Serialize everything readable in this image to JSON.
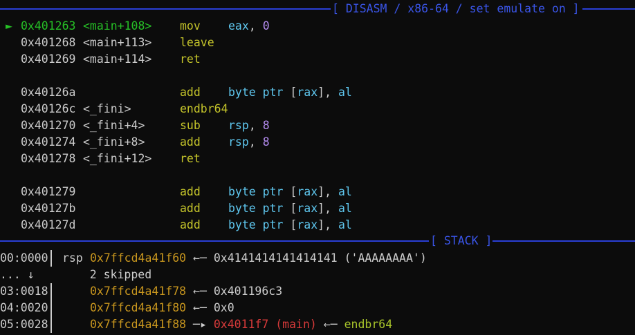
{
  "disasm": {
    "header": "[ DISASM / x86-64 / set emulate on ]",
    "current_marker": "►",
    "rows": [
      {
        "addr": "0x401263",
        "sym": "<main+108>",
        "mnem": "mov",
        "ops": [
          {
            "t": "eax",
            "c": "reg"
          },
          {
            "t": ", ",
            "c": "plain"
          },
          {
            "t": "0",
            "c": "num"
          }
        ],
        "current": true
      },
      {
        "addr": "0x401268",
        "sym": "<main+113>",
        "mnem": "leave",
        "ops": []
      },
      {
        "addr": "0x401269",
        "sym": "<main+114>",
        "mnem": "ret",
        "ops": []
      },
      {
        "blank": true
      },
      {
        "addr": "0x40126a",
        "sym": "",
        "mnem": "add",
        "ops": [
          {
            "t": "byte ptr ",
            "c": "reg"
          },
          {
            "t": "[",
            "c": "plain"
          },
          {
            "t": "rax",
            "c": "reg"
          },
          {
            "t": "], ",
            "c": "plain"
          },
          {
            "t": "al",
            "c": "reg"
          }
        ]
      },
      {
        "addr": "0x40126c",
        "sym": "<_fini>",
        "mnem": "endbr64",
        "ops": []
      },
      {
        "addr": "0x401270",
        "sym": "<_fini+4>",
        "mnem": "sub",
        "ops": [
          {
            "t": "rsp",
            "c": "reg"
          },
          {
            "t": ", ",
            "c": "plain"
          },
          {
            "t": "8",
            "c": "num"
          }
        ]
      },
      {
        "addr": "0x401274",
        "sym": "<_fini+8>",
        "mnem": "add",
        "ops": [
          {
            "t": "rsp",
            "c": "reg"
          },
          {
            "t": ", ",
            "c": "plain"
          },
          {
            "t": "8",
            "c": "num"
          }
        ]
      },
      {
        "addr": "0x401278",
        "sym": "<_fini+12>",
        "mnem": "ret",
        "ops": []
      },
      {
        "blank": true
      },
      {
        "addr": "0x401279",
        "sym": "",
        "mnem": "add",
        "ops": [
          {
            "t": "byte ptr ",
            "c": "reg"
          },
          {
            "t": "[",
            "c": "plain"
          },
          {
            "t": "rax",
            "c": "reg"
          },
          {
            "t": "], ",
            "c": "plain"
          },
          {
            "t": "al",
            "c": "reg"
          }
        ]
      },
      {
        "addr": "0x40127b",
        "sym": "",
        "mnem": "add",
        "ops": [
          {
            "t": "byte ptr ",
            "c": "reg"
          },
          {
            "t": "[",
            "c": "plain"
          },
          {
            "t": "rax",
            "c": "reg"
          },
          {
            "t": "], ",
            "c": "plain"
          },
          {
            "t": "al",
            "c": "reg"
          }
        ]
      },
      {
        "addr": "0x40127d",
        "sym": "",
        "mnem": "add",
        "ops": [
          {
            "t": "byte ptr ",
            "c": "reg"
          },
          {
            "t": "[",
            "c": "plain"
          },
          {
            "t": "rax",
            "c": "reg"
          },
          {
            "t": "], ",
            "c": "plain"
          },
          {
            "t": "al",
            "c": "reg"
          }
        ]
      }
    ]
  },
  "stack": {
    "header": "[ STACK ]",
    "rows": [
      {
        "index": "00:0000",
        "reg": "rsp",
        "parts": [
          {
            "t": "0x7ffcd4a41f60",
            "c": "stackaddr"
          },
          {
            "t": " ←─ ",
            "c": "plain"
          },
          {
            "t": "0x4141414141414141 ('AAAAAAAA')",
            "c": "plain"
          }
        ]
      },
      {
        "index": "... ↓",
        "reg": "",
        "parts": [
          {
            "t": "    2 skipped",
            "c": "plain"
          }
        ],
        "nobar": true
      },
      {
        "index": "03:0018",
        "reg": "",
        "parts": [
          {
            "t": "0x7ffcd4a41f78",
            "c": "stackaddr"
          },
          {
            "t": " ←─ ",
            "c": "plain"
          },
          {
            "t": "0x401196c3",
            "c": "plain"
          }
        ]
      },
      {
        "index": "04:0020",
        "reg": "",
        "parts": [
          {
            "t": "0x7ffcd4a41f80",
            "c": "stackaddr"
          },
          {
            "t": " ←─ ",
            "c": "plain"
          },
          {
            "t": "0x0",
            "c": "plain"
          }
        ]
      },
      {
        "index": "05:0028",
        "reg": "",
        "parts": [
          {
            "t": "0x7ffcd4a41f88",
            "c": "stackaddr"
          },
          {
            "t": " ─▸ ",
            "c": "plain"
          },
          {
            "t": "0x4011f7 (main)",
            "c": "red"
          },
          {
            "t": " ←─ ",
            "c": "plain"
          },
          {
            "t": "endbr64",
            "c": "green"
          }
        ]
      }
    ]
  },
  "colors": {
    "background": "#0c0c0c",
    "separator": "#2a3fd6",
    "current_line": "#26c026",
    "mnemonic": "#c4c42a",
    "register": "#5fc8f0",
    "immediate": "#b48cf0",
    "stack_address": "#c8961e",
    "symbol_red": "#d83a3a",
    "instruction_green": "#a8c42a"
  }
}
